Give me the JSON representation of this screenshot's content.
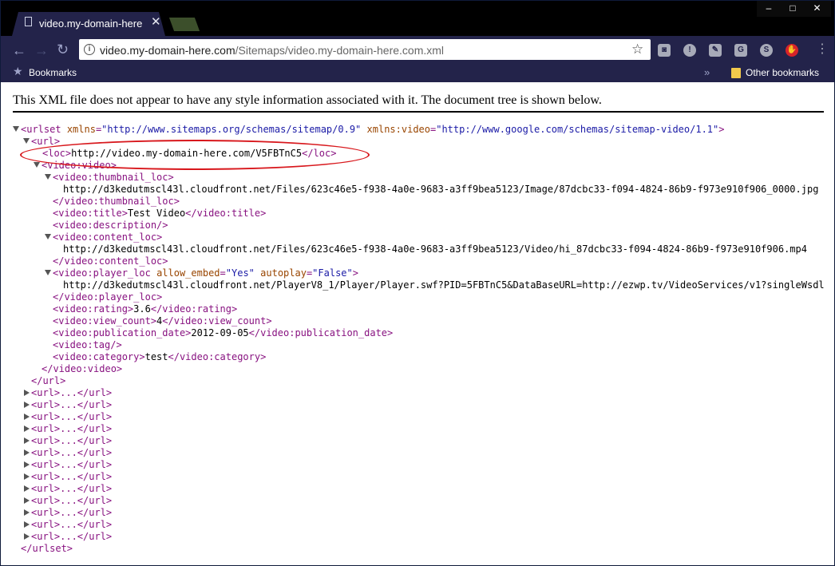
{
  "browser": {
    "tab_title": "video.my-domain-here.c",
    "tab_close": "✕",
    "url_host": "video.my-domain-here.com",
    "url_path": "/Sitemaps/video.my-domain-here.com.xml",
    "bookmarks_label": "Bookmarks",
    "other_bookmarks_label": "Other bookmarks",
    "more_bookmarks": "»",
    "window_min": "–",
    "window_max": "□",
    "window_close": "✕",
    "extensions": [
      "camera-icon",
      "info-circle-icon",
      "bookmark-ext-icon",
      "g-ext-icon",
      "skype-icon",
      "adblock-icon"
    ]
  },
  "page": {
    "message": "This XML file does not appear to have any style information associated with it. The document tree is shown below."
  },
  "xml": {
    "urlset_open_tag": "<urlset",
    "xmlns_attr": "xmlns",
    "xmlns_val": "\"http://www.sitemaps.org/schemas/sitemap/0.9\"",
    "xmlns_video_attr": "xmlns:video",
    "xmlns_video_val": "\"http://www.google.com/schemas/sitemap-video/1.1\"",
    "url_open": "<url>",
    "loc_open": "<loc>",
    "loc_value": "http://video.my-domain-here.com/V5FBTnC5",
    "loc_close": "</loc>",
    "video_open": "<video:video>",
    "thumb_open": "<video:thumbnail_loc>",
    "thumb_value": "http://d3kedutmscl43l.cloudfront.net/Files/623c46e5-f938-4a0e-9683-a3ff9bea5123/Image/87dcbc33-f094-4824-86b9-f973e910f906_0000.jpg",
    "thumb_close": "</video:thumbnail_loc>",
    "title_open": "<video:title>",
    "title_value": "Test Video",
    "title_close": "</video:title>",
    "description": "<video:description/>",
    "content_open": "<video:content_loc>",
    "content_value": "http://d3kedutmscl43l.cloudfront.net/Files/623c46e5-f938-4a0e-9683-a3ff9bea5123/Video/hi_87dcbc33-f094-4824-86b9-f973e910f906.mp4",
    "content_close": "</video:content_loc>",
    "player_open": "<video:player_loc",
    "player_attr1": "allow_embed",
    "player_val1": "\"Yes\"",
    "player_attr2": "autoplay",
    "player_val2": "\"False\"",
    "player_value": "http://d3kedutmscl43l.cloudfront.net/PlayerV8_1/Player/Player.swf?PID=5FBTnC5&DataBaseURL=http://ezwp.tv/VideoServices/v1?singleWsdl",
    "player_close": "</video:player_loc>",
    "rating_open": "<video:rating>",
    "rating_value": "3.6",
    "rating_close": "</video:rating>",
    "view_open": "<video:view_count>",
    "view_value": "4",
    "view_close": "</video:view_count>",
    "pub_open": "<video:publication_date>",
    "pub_value": "2012-09-05",
    "pub_close": "</video:publication_date>",
    "tag": "<video:tag/>",
    "cat_open": "<video:category>",
    "cat_value": "test",
    "cat_close": "</video:category>",
    "video_close": "</video:video>",
    "url_close": "</url>",
    "collapsed_url": "<url>...</url>",
    "urlset_close": "</urlset>"
  }
}
